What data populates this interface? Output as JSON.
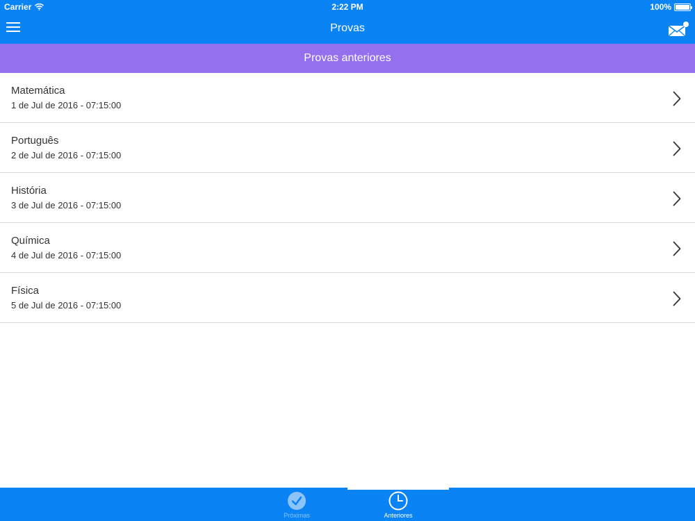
{
  "status_bar": {
    "carrier": "Carrier",
    "time": "2:22 PM",
    "battery": "100%",
    "battery_level": 1.0
  },
  "nav": {
    "title": "Provas",
    "menu_icon": "hamburger-menu-icon",
    "mail_icon": "mail-notification-icon"
  },
  "segment": {
    "title": "Provas anteriores"
  },
  "list": {
    "items": [
      {
        "title": "Matemática",
        "date": "1 de Jul de 2016 - 07:15:00"
      },
      {
        "title": "Português",
        "date": "2 de Jul de 2016 - 07:15:00"
      },
      {
        "title": "História",
        "date": "3 de Jul de 2016 - 07:15:00"
      },
      {
        "title": "Química",
        "date": "4 de Jul de 2016 - 07:15:00"
      },
      {
        "title": "Física",
        "date": "5 de Jul de 2016 - 07:15:00"
      }
    ]
  },
  "tabs": {
    "proximas": {
      "label": "Próximas",
      "icon": "checkmark-circle-icon",
      "active": false
    },
    "anteriores": {
      "label": "Anteriores",
      "icon": "clock-icon",
      "active": true
    }
  },
  "colors": {
    "primary": "#0a84f4",
    "segment": "#9470ef",
    "inactive_tab": "#8cc4fa",
    "divider": "#d8d8d8",
    "text": "#333333"
  }
}
